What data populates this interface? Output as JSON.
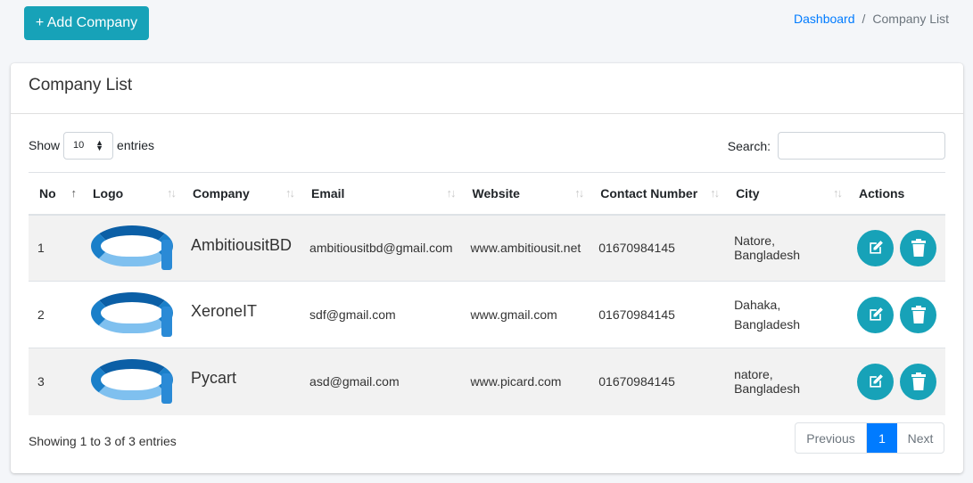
{
  "toolbar": {
    "add_label": "+ Add Company"
  },
  "breadcrumb": {
    "home": "Dashboard",
    "sep": "/",
    "current": "Company List"
  },
  "card": {
    "title": "Company List"
  },
  "length": {
    "show": "Show",
    "value": "10",
    "entries": "entries"
  },
  "search": {
    "label": "Search:"
  },
  "columns": [
    "No",
    "Logo",
    "Company",
    "Email",
    "Website",
    "Contact Number",
    "City",
    "Actions"
  ],
  "rows": [
    {
      "no": "1",
      "company": "AmbitiousitBD",
      "email": "ambitiousitbd@gmail.com",
      "website": "www.ambitiousit.net",
      "contact": "01670984145",
      "city": "Natore, Bangladesh"
    },
    {
      "no": "2",
      "company": "XeroneIT",
      "email": "sdf@gmail.com",
      "website": "www.gmail.com",
      "contact": "01670984145",
      "city": "Dahaka, Bangladesh"
    },
    {
      "no": "3",
      "company": "Pycart",
      "email": "asd@gmail.com",
      "website": "www.picard.com",
      "contact": "01670984145",
      "city": "natore, Bangladesh"
    }
  ],
  "footer": {
    "info": "Showing 1 to 3 of 3 entries"
  },
  "pagination": {
    "previous": "Previous",
    "current": "1",
    "next": "Next"
  },
  "icons": {
    "edit": "edit-icon",
    "delete": "trash-icon",
    "sort": "sort-arrows-icon"
  },
  "colors": {
    "accent": "#17a2b8",
    "primary": "#007bff"
  }
}
